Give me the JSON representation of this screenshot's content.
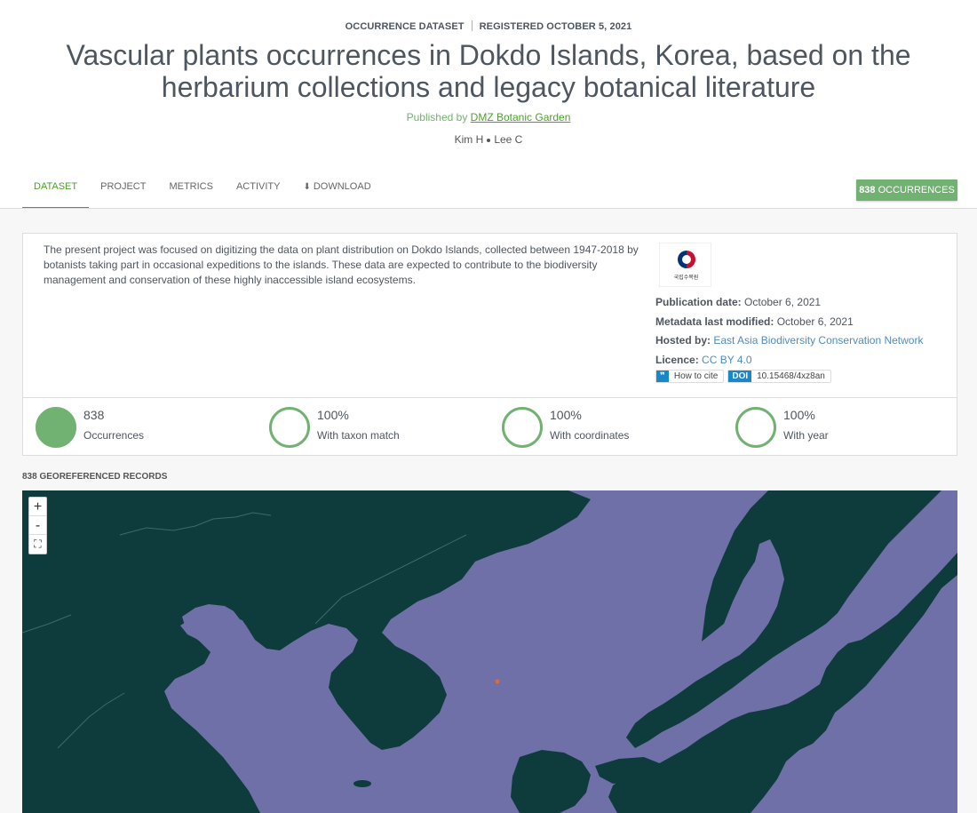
{
  "header": {
    "dataset_type": "OCCURRENCE DATASET",
    "registered": "REGISTERED OCTOBER 5, 2021",
    "title": "Vascular plants occurrences in Dokdo Islands, Korea, based on the herbarium collections and legacy botanical literature",
    "published_prefix": "Published by",
    "publisher": "DMZ Botanic Garden",
    "authors": [
      "Kim H",
      "Lee C"
    ]
  },
  "tabs": [
    {
      "label": "DATASET",
      "active": true
    },
    {
      "label": "PROJECT",
      "active": false
    },
    {
      "label": "METRICS",
      "active": false
    },
    {
      "label": "ACTIVITY",
      "active": false
    },
    {
      "label": "DOWNLOAD",
      "active": false,
      "icon": "download-icon"
    }
  ],
  "occurrences_badge": {
    "count": "838",
    "label": "OCCURRENCES"
  },
  "description": "The present project was focused on digitizing the data on plant distribution on Dokdo Islands, collected between 1947-2018 by botanists taking part in occasional expeditions to the islands. These data are expected to contribute to the biodiversity management and conservation of these highly inaccessible island ecosystems.",
  "logo": {
    "text": "국립수목원"
  },
  "facts": {
    "publication_date_label": "Publication date:",
    "publication_date": "October 6, 2021",
    "metadata_modified_label": "Metadata last modified:",
    "metadata_modified": "October 6, 2021",
    "hosted_by_label": "Hosted by:",
    "hosted_by": "East Asia Biodiversity Conservation Network",
    "licence_label": "Licence:",
    "licence": "CC BY 4.0"
  },
  "cite": {
    "quote_icon": "quote-icon",
    "how_to_cite": "How to cite",
    "doi_tag": "DOI",
    "doi": "10.15468/4xz8an"
  },
  "stats": [
    {
      "value": "838",
      "label": "Occurrences",
      "fill": 1.0
    },
    {
      "value": "100%",
      "label": "With taxon match",
      "fill": 1.0
    },
    {
      "value": "100%",
      "label": "With coordinates",
      "fill": 1.0
    },
    {
      "value": "100%",
      "label": "With year",
      "fill": 1.0
    }
  ],
  "map": {
    "records_label": "838 GEOREFERENCED RECORDS",
    "zoom_in": "+",
    "zoom_out": "-",
    "fullscreen_icon": "fullscreen-icon",
    "colors": {
      "sea": "#7070a8",
      "land": "#0e3b3c",
      "marker": "#e06a2c"
    }
  },
  "colors": {
    "accent": "#71b171",
    "link": "#4f8bc4",
    "doi": "#1a87c8"
  }
}
